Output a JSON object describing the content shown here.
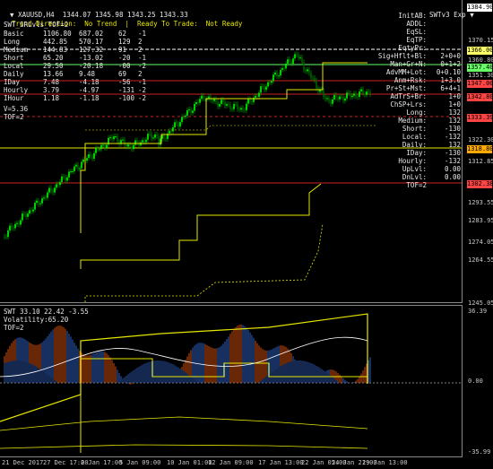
{
  "symbol_title": "XAUUSD,H4  1344.07 1345.98 1343.25 1343.33",
  "right_header": "SWTv3 Exp",
  "status_line": {
    "trend": "Trend Direction:  No Trend",
    "ready": "Ready To Trade:  Not Ready"
  },
  "indicator_name": "SWT_SRLvls_TOF=2",
  "left_table": [
    {
      "name": "Basic",
      "v1": "1106.80",
      "v2": "687.02",
      "v3": "62",
      "v4": "-1"
    },
    {
      "name": "Long",
      "v1": "442.85",
      "v2": "570.17",
      "v3": "129",
      "v4": "2"
    },
    {
      "name": "Medium",
      "v1": "144.83",
      "v2": "127.32",
      "v3": "91",
      "v4": "2"
    },
    {
      "name": "Short",
      "v1": "65.20",
      "v2": "-13.02",
      "v3": "-20",
      "v4": "-1"
    },
    {
      "name": "Local",
      "v1": "29.50",
      "v2": "-20.18",
      "v3": "-00",
      "v4": "-2"
    },
    {
      "name": "Daily",
      "v1": "13.66",
      "v2": "9.48",
      "v3": "69",
      "v4": "2"
    },
    {
      "name": "IDay",
      "v1": "7.48",
      "v2": "-4.18",
      "v3": "-56",
      "v4": "-1"
    },
    {
      "name": "Hourly",
      "v1": "3.79",
      "v2": "-4.97",
      "v3": "-131",
      "v4": "-2"
    },
    {
      "name": "IHour",
      "v1": "1.18",
      "v2": "-1.18",
      "v3": "-100",
      "v4": "-2"
    }
  ],
  "vline": "V=5.36",
  "tof": "TOF=2",
  "right_table": [
    {
      "k": "InitAB:",
      "v": ""
    },
    {
      "k": "ADDL:",
      "v": ""
    },
    {
      "k": "EqSL:",
      "v": ""
    },
    {
      "k": "EqTP:",
      "v": ""
    },
    {
      "k": "EqtyPr:",
      "v": ""
    },
    {
      "k": "Sig+Hflt+Bl:",
      "v": "2+0+0"
    },
    {
      "k": "Man+Gr+N:",
      "v": "0+1+2"
    },
    {
      "k": "AdvMM+Lot:",
      "v": "0+0.10"
    },
    {
      "k": "Anm+Rsk:",
      "v": "1+3.0"
    },
    {
      "k": "Pr+St+Mst:",
      "v": "6+4+1"
    },
    {
      "k": "AdTrS+Br:",
      "v": "1+0"
    },
    {
      "k": "ChSP+Lrs:",
      "v": "1+0"
    },
    {
      "k": "Long:",
      "v": "132"
    },
    {
      "k": "Medium:",
      "v": "132"
    },
    {
      "k": "Short:",
      "v": "-130"
    },
    {
      "k": "Local:",
      "v": "-132"
    },
    {
      "k": "Daily:",
      "v": "132"
    },
    {
      "k": "IDay:",
      "v": "-130"
    },
    {
      "k": "Hourly:",
      "v": "-132"
    },
    {
      "k": "UpLvl:",
      "v": "0.00"
    },
    {
      "k": "DnLvl:",
      "v": "0.00"
    },
    {
      "k": "TOF=2",
      "v": ""
    }
  ],
  "price_tags": [
    {
      "label": "1384.90",
      "color": "#ffffff"
    },
    {
      "label": "1366.00",
      "color": "#ffff66"
    },
    {
      "label": "1357.40",
      "color": "#66ff66"
    },
    {
      "label": "1347.00",
      "color": "#ff4444"
    },
    {
      "label": "1342.80",
      "color": "#ff4444"
    },
    {
      "label": "1333.39",
      "color": "#ff4444"
    },
    {
      "label": "1318.80",
      "color": "#ffaa00"
    },
    {
      "label": "1302.38",
      "color": "#ff4444"
    }
  ],
  "price_axis": [
    "1370.15",
    "1360.80",
    "1351.30",
    "1322.30",
    "1312.85",
    "1293.55",
    "1283.95",
    "1274.05",
    "1264.55",
    "1245.05"
  ],
  "sub_title": "SWT 33.10 22.42 -3.55",
  "sub_volatility": "Volatility:65.20",
  "sub_tof": "TOF=2",
  "sub_axis": [
    "36.39",
    "0.00",
    "-35.99"
  ],
  "time_axis": [
    "21 Dec 2017",
    "27 Dec 17:00",
    "2 Jan 17:00",
    "5 Jan 09:00",
    "10 Jan 01:00",
    "12 Jan 09:00",
    "17 Jan 13:00",
    "22 Jan 05:00",
    "24 Jan 21:00",
    "29 Jan 13:00"
  ],
  "colors": {
    "candle_up": "#00c000",
    "candle_down": "#00ff00",
    "level_yellow": "#e6e600",
    "level_red": "#cc2222",
    "level_white": "#ffffff",
    "level_green": "#66ff66",
    "level_orange": "#ffaa00"
  }
}
